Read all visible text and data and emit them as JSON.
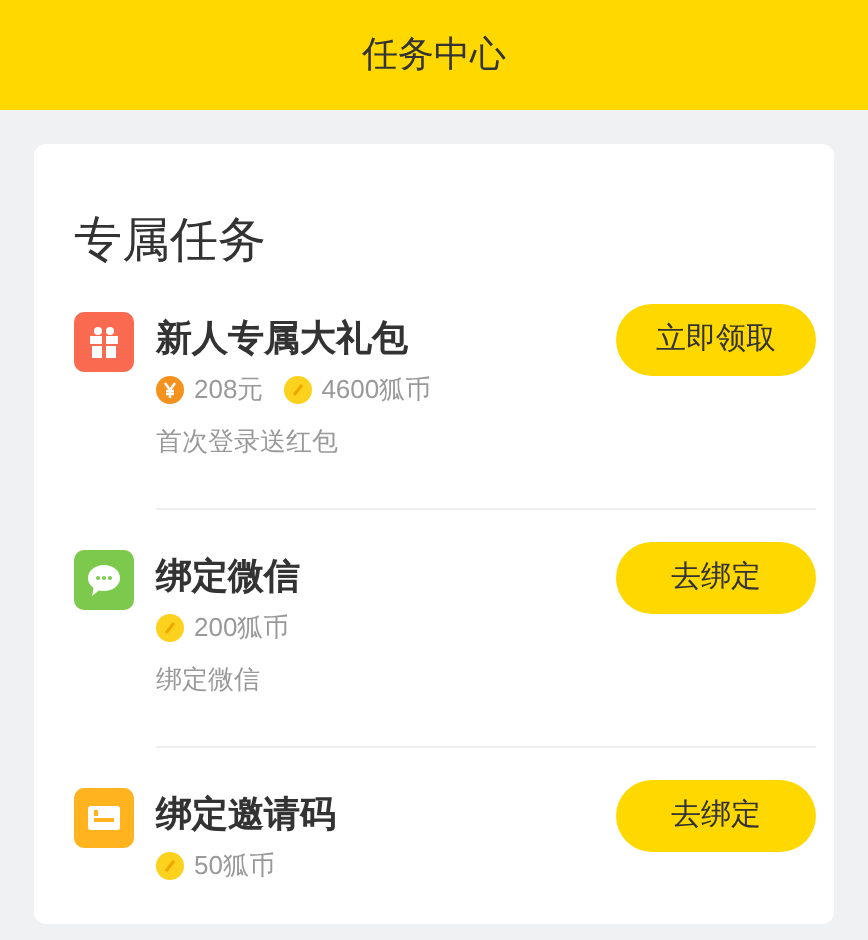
{
  "header": {
    "title": "任务中心"
  },
  "section": {
    "title": "专属任务"
  },
  "tasks": [
    {
      "kind": "gift",
      "color": "#fa6a50",
      "title": "新人专属大礼包",
      "rewards": [
        {
          "kind": "cash",
          "text": "208元"
        },
        {
          "kind": "coin",
          "text": "4600狐币"
        }
      ],
      "description": "首次登录送红包",
      "button": "立即领取"
    },
    {
      "kind": "chat",
      "color": "#7dc94e",
      "title": "绑定微信",
      "rewards": [
        {
          "kind": "coin",
          "text": "200狐币"
        }
      ],
      "description": "绑定微信",
      "button": "去绑定"
    },
    {
      "kind": "card",
      "color": "#ffb41f",
      "title": "绑定邀请码",
      "rewards": [
        {
          "kind": "coin",
          "text": "50狐币"
        }
      ],
      "button": "去绑定"
    }
  ]
}
